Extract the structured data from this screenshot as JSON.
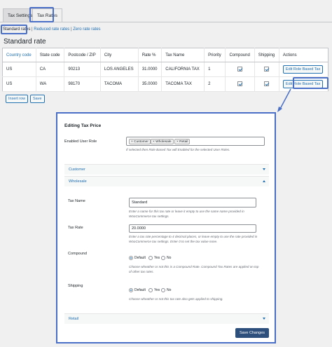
{
  "tabs": [
    {
      "label": "Tax Settings"
    },
    {
      "label": "Tax Rates"
    }
  ],
  "sublinks": {
    "current": "Standard rates",
    "sep": " | ",
    "reduced": "Reduced rate rates",
    "zero": "Zero rate rates"
  },
  "section_title": "Standard rate",
  "table": {
    "headers": [
      "Country code",
      "State code",
      "Postcode / ZIP",
      "City",
      "Rate %",
      "Tax Name",
      "Priority",
      "Compound",
      "Shipping",
      "Actions"
    ],
    "rows": [
      {
        "country": "US",
        "state": "CA",
        "zip": "90213",
        "city": "LOS ANGELES",
        "rate": "31.0000",
        "name": "CALIFORNIA TAX",
        "priority": "1",
        "compound": true,
        "shipping": true,
        "action": "Edit Role Based Tax"
      },
      {
        "country": "US",
        "state": "WA",
        "zip": "98170",
        "city": "TACOMA",
        "rate": "35.0000",
        "name": "TACOMA TAX",
        "priority": "2",
        "compound": true,
        "shipping": true,
        "action": "Edit Role Based Tax"
      }
    ]
  },
  "buttons": {
    "insert_row": "Insert row",
    "save": "Save"
  },
  "panel": {
    "title": "Editing Tax Price",
    "enabled_roles_label": "Enabled User Role",
    "roles": [
      "Customer",
      "Wholesale",
      "Retail"
    ],
    "roles_help": "If selected then Role Based Tax will Enabled for the selected User Roles.",
    "accordions": {
      "customer": "Customer",
      "wholesale": "Wholesale",
      "retail": "Retail"
    },
    "tax_name_label": "Tax Name",
    "tax_name_value": "Standard",
    "tax_name_help": "Enter a name for this tax rate or leave it empty to use the same name provided in WooCommerce tax settings.",
    "tax_rate_label": "Tax Rate",
    "tax_rate_value": "20.0000",
    "tax_rate_help": "Enter a tax rate percentage to 4 decimal places, or leave empty to use the rate provided in WooCommerce tax settings. Enter 0 to set the tax value none.",
    "compound_label": "Compound",
    "compound_help": "Choose wheather or not this is a Compound Rate. Compound Tax Rates are applied on top of other tax rates.",
    "shipping_label": "Shipping",
    "shipping_help": "Choose wheather or not this tax rate also gets applied to shipping.",
    "radio_options": [
      "Default",
      "Yes",
      "No"
    ],
    "save_changes": "Save Changes"
  }
}
